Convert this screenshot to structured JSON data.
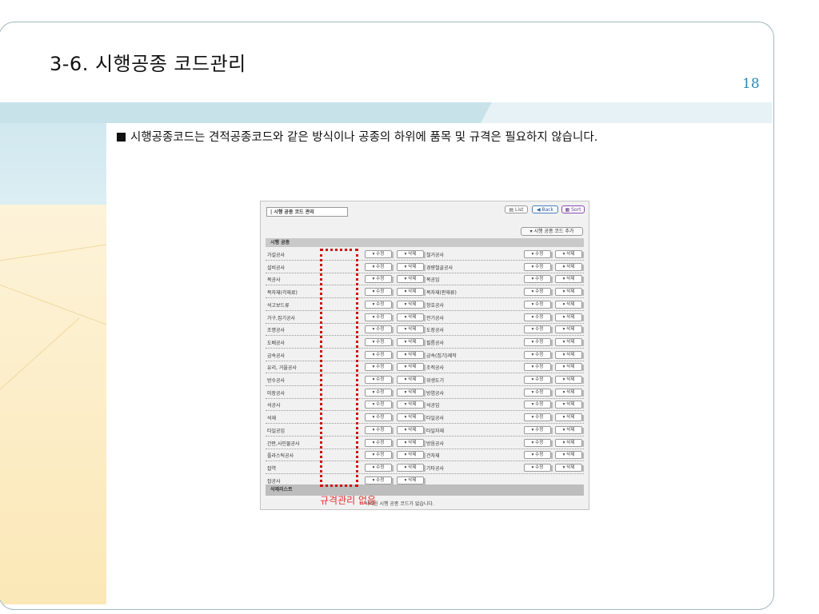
{
  "slide": {
    "title": "3-6. 시행공종 코드관리",
    "page_number": "18",
    "bullet_text": "시행공종코드는 견적공종코드와 같은 방식이나 공종의 하위에 품목 및 규격은 필요하지 않습니다."
  },
  "app": {
    "header_title": "| 시행 공종 코드 관리",
    "toolbar": {
      "list_label": "List",
      "back_label": "Back",
      "sort_label": "Sort"
    },
    "add_button_label": "▾ 시행 공종 코드 추가",
    "section_title": "시행 공종",
    "edit_label": "▾ 수정",
    "delete_label": "▾ 삭제",
    "left_items": [
      "가설공사",
      "설비공사",
      "목공사",
      "목자재(각재료)",
      "석고보드류",
      "가구,집기공사",
      "조명공사",
      "도배공사",
      "금속공사",
      "유리, 거울공사",
      "방수공사",
      "미장공사",
      "석공사",
      "석재",
      "타일공임",
      "간판,사인물공사",
      "플라스틱공사",
      "잡역",
      "잡공사"
    ],
    "right_items": [
      "철거공사",
      "경량철골공사",
      "목공임",
      "목자재(판재류)",
      "창호공사",
      "전기공사",
      "도장공사",
      "필름공사",
      "금속(집기)제작",
      "조적공사",
      "위생도기",
      "방염공사",
      "석공임",
      "타일공사",
      "타일자재",
      "방음공사",
      "건자재",
      "기타공사"
    ],
    "deleted_section_title": "삭제리스트",
    "deleted_note": "삭제된 시행 공종 코드가 없습니다."
  },
  "annotation": {
    "text": "규격관리 없음",
    "color": "#e03030"
  },
  "colors": {
    "accent": "#2a86b0",
    "band_blue": "#cfe7ef",
    "band_cream": "#fbe8b7"
  }
}
